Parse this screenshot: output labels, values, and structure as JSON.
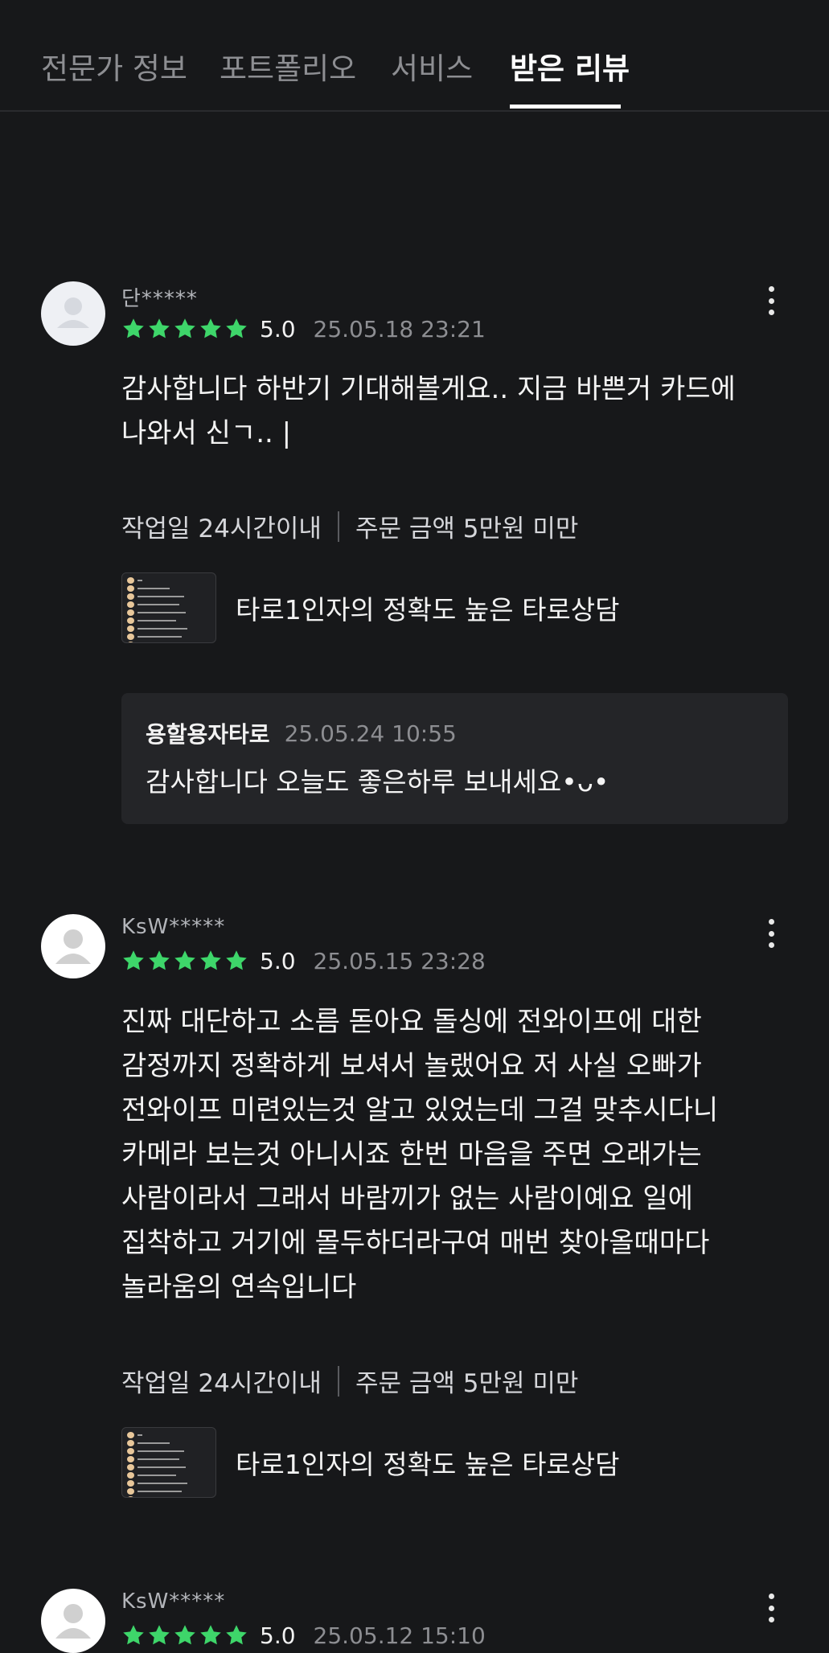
{
  "tabs": [
    {
      "label": "전문가 정보"
    },
    {
      "label": "포트폴리오"
    },
    {
      "label": "서비스"
    },
    {
      "label": "받은 리뷰"
    }
  ],
  "active_tab": "받은 리뷰",
  "colors": {
    "star": "#3ed66a",
    "background": "#17181a",
    "reply_bg": "#242528"
  },
  "reviews": [
    {
      "name": "단*****",
      "stars": 5,
      "score": "5.0",
      "date": "25.05.18 23:21",
      "text_lines": [
        "감사합니다 하반기 기대해볼게요.. 지금 바쁜거 카드에",
        "나와서 신ㄱ.. |"
      ],
      "work_days": "작업일 24시간이내",
      "order_amount": "주문 금액 5만원 미만",
      "service_title": "타로1인자의 정확도 높은 타로상담",
      "reply": {
        "name": "용할용자타로",
        "date": "25.05.24 10:55",
        "text": "감사합니다 오늘도 좋은하루 보내세요•ᴗ•"
      }
    },
    {
      "name": "KsW*****",
      "stars": 5,
      "score": "5.0",
      "date": "25.05.15 23:28",
      "text_lines": [
        "진짜 대단하고 소름 돋아요 돌싱에 전와이프에 대한",
        "감정까지 정확하게 보셔서 놀랬어요 저 사실 오빠가",
        "전와이프 미련있는것 알고 있었는데 그걸 맞추시다니",
        "카메라 보는것 아니시죠 한번 마음을 주면 오래가는",
        "사람이라서 그래서 바람끼가 없는 사람이예요 일에",
        "집착하고 거기에 몰두하더라구여 매번 찾아올때마다",
        "놀라움의 연속입니다"
      ],
      "work_days": "작업일 24시간이내",
      "order_amount": "주문 금액 5만원 미만",
      "service_title": "타로1인자의 정확도 높은 타로상담"
    },
    {
      "name": "KsW*****",
      "stars": 5,
      "score": "5.0",
      "date": "25.05.12 15:10"
    }
  ]
}
